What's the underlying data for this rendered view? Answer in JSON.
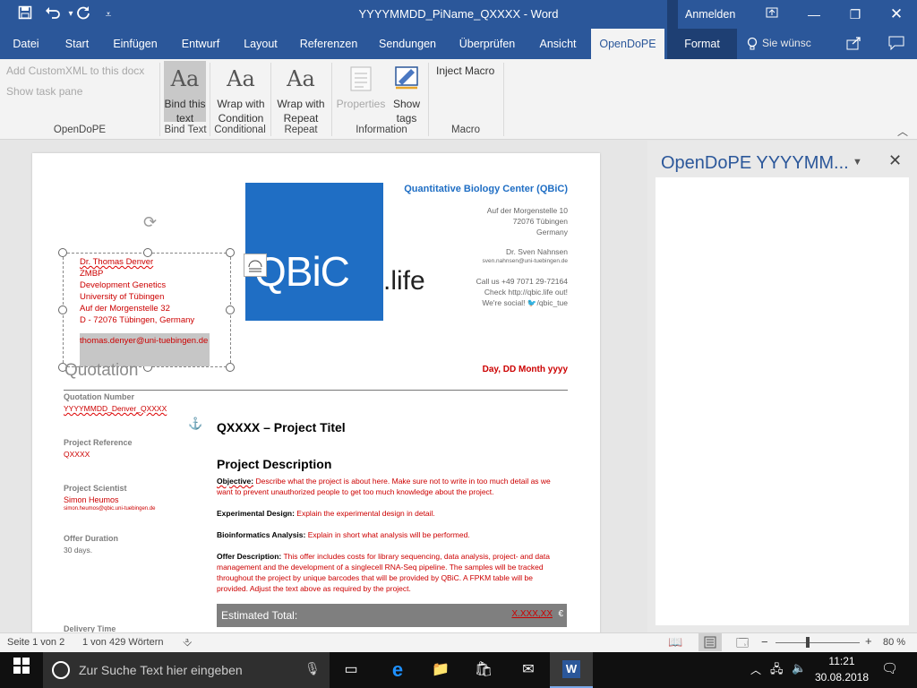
{
  "titlebar": {
    "document_title": "YYYYMMDD_PiName_QXXXX - Word",
    "sign_in": "Anmelden",
    "save_icon": "save-icon",
    "undo_icon": "undo-icon",
    "redo_icon": "redo-icon"
  },
  "tabs": [
    "Datei",
    "Start",
    "Einfügen",
    "Entwurf",
    "Layout",
    "Referenzen",
    "Sendungen",
    "Überprüfen",
    "Ansicht",
    "OpenDoPE",
    "Format"
  ],
  "tell_me": "Sie wünsc",
  "ribbon": {
    "add_customxml": "Add CustomXML to this docx",
    "show_task_pane": "Show task pane",
    "group_opendope": "OpenDoPE",
    "bind_label": "Bind this text",
    "group_bind": "Bind Text",
    "wrap_cond_label": "Wrap with Condition",
    "group_conditional": "Conditional",
    "wrap_repeat_label": "Wrap with Repeat",
    "group_repeat": "Repeat",
    "properties_label": "Properties",
    "show_tags_label": "Show tags",
    "group_information": "Information",
    "inject_macro_label": "Inject Macro",
    "group_macro": "Macro",
    "aa_glyph": "Aa"
  },
  "document": {
    "address_lines": [
      "Dr. Thomas Denver",
      "ZMBP",
      "Development Genetics",
      "University of Tübingen",
      "Auf der Morgenstelle 32",
      "D - 72076 Tübingen, Germany"
    ],
    "email": "thomas.denyer@uni-tuebingen.de",
    "logo_main": "QBiC",
    "logo_suffix": ".life",
    "org_name": "Quantitative Biology Center (QBiC)",
    "org_address": [
      "Auf der Morgenstelle 10",
      "72076 Tübingen",
      "Germany"
    ],
    "contact_name": "Dr. Sven Nahnsen",
    "contact_email": "sven.nahnsen@uni-tuebingen.de",
    "org_contact_lines": [
      "Call us +49 7071 29-72164",
      "Check http://qbic.life out!",
      "We're social! "
    ],
    "twitter": "/qbic_tue",
    "heading": "Quotation",
    "date": "Day, DD Month yyyy",
    "quotation_number_label": "Quotation Number",
    "quotation_number": "YYYYMMDD_Denver_QXXXX",
    "project_reference_label": "Project Reference",
    "project_reference": "QXXXX",
    "project_scientist_label": "Project Scientist",
    "project_scientist": "Simon Heumos",
    "project_scientist_email": "simon.heumos@qbic.uni-tuebingen.de",
    "offer_duration_label": "Offer Duration",
    "offer_duration": "30 days.",
    "delivery_time_label": "Delivery Time",
    "project_title": "QXXXX – Project Titel",
    "project_description_heading": "Project Description",
    "objective_label": "Objective:",
    "objective_text": " Describe what the project is about here. Make sure not to write in too much detail as we want to prevent unauthorized people to get too much knowledge about the project.",
    "experimental_label": "Experimental Design:",
    "experimental_text": " Explain the experimental design in detail.",
    "bioinf_label": "Bioinformatics Analysis:",
    "bioinf_text": " Explain in short what analysis will be performed.",
    "offer_desc_label": "Offer Description:",
    "offer_desc_text": " This offer includes costs for library sequencing, data analysis, project- and data management and the development of a singlecell RNA-Seq pipeline. The samples will be tracked throughout the project by unique barcodes that will be provided by QBiC. A FPKM table will be provided.                 Adjust the text above as required by the project.",
    "estimated_total_label": "Estimated Total:",
    "estimated_total_value": "X.XXX,XX",
    "currency": "€"
  },
  "pane": {
    "title": "OpenDoPE YYYYMM...",
    "dropdown_icon": "chevron-down-icon",
    "close_icon": "close-icon"
  },
  "status": {
    "page": "Seite 1 von 2",
    "words": "1 von 429 Wörtern",
    "zoom": "80 %"
  },
  "taskbar": {
    "search_placeholder": "Zur Suche Text hier eingeben",
    "time": "11:21",
    "date": "30.08.2018"
  }
}
